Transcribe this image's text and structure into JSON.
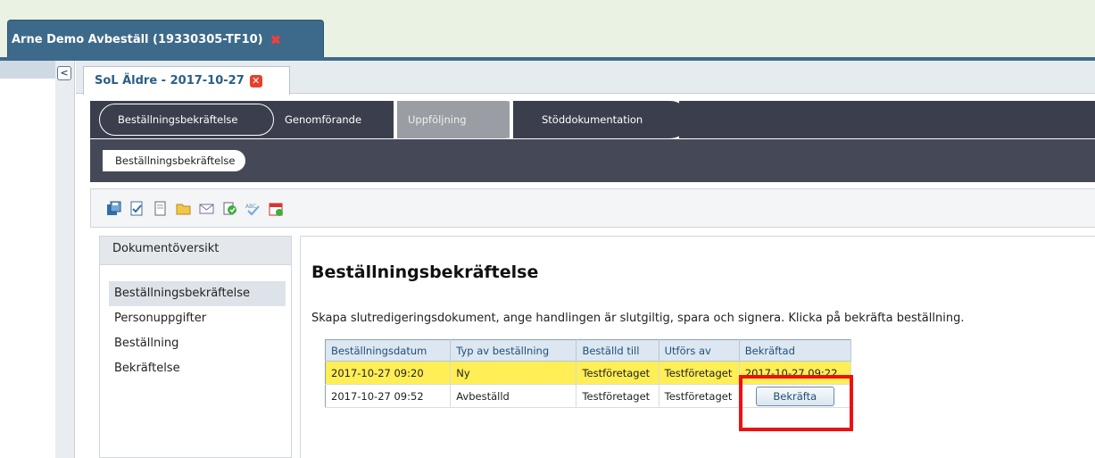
{
  "window_tab": {
    "title": "Arne Demo Avbeställ (19330305-TF10)",
    "close_symbol": "✖"
  },
  "collapse_symbol": "<",
  "document_tab": {
    "title": "SoL Äldre - 2017-10-27",
    "close_symbol": "✕"
  },
  "phases": [
    "Beställningsbekräftelse",
    "Genomförande",
    "Uppföljning",
    "Stöddokumentation"
  ],
  "sub_phase": "Beställningsbekräftelse",
  "toolbar_icons": [
    "save-icon",
    "checklist-icon",
    "document-icon",
    "folder-icon",
    "mail-icon",
    "refresh-icon",
    "spellcheck-icon",
    "calendar-icon"
  ],
  "document_overview": {
    "heading": "Dokumentöversikt",
    "items": [
      "Beställningsbekräftelse",
      "Personuppgifter",
      "Beställning",
      "Bekräftelse"
    ]
  },
  "main": {
    "title": "Beställningsbekräftelse",
    "description": "Skapa slutredigeringsdokument, ange handlingen är slutgiltig, spara och signera. Klicka på bekräfta beställning."
  },
  "table": {
    "columns": [
      "Beställningsdatum",
      "Typ av beställning",
      "Beställd till",
      "Utförs av",
      "Bekräftad"
    ],
    "rows": [
      {
        "date": "2017-10-27 09:20",
        "type": "Ny",
        "ordered_to": "Testföretaget",
        "performed_by": "Testföretaget",
        "confirmed": "2017-10-27 09:22"
      },
      {
        "date": "2017-10-27 09:52",
        "type": "Avbeställd",
        "ordered_to": "Testföretaget",
        "performed_by": "Testföretaget",
        "confirmed_button": "Bekräfta"
      }
    ]
  },
  "colors": {
    "highlight_row": "#ffee55",
    "annotation_box": "#ee1111",
    "tab_blue": "#3d6a8a"
  }
}
